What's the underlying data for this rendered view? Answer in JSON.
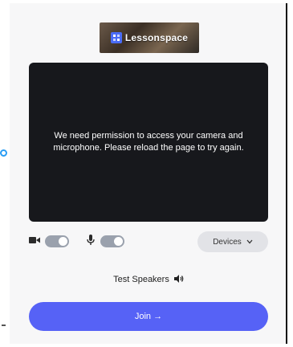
{
  "brand": {
    "name": "Lessonspace",
    "accent": "#4a6cf7",
    "icon": "lessonspace-logo-icon"
  },
  "video": {
    "message": "We need permission to access your camera and microphone. Please reload the page to try again."
  },
  "controls": {
    "camera_icon": "camera-icon",
    "camera_enabled": true,
    "mic_icon": "microphone-icon",
    "mic_enabled": true,
    "devices_label": "Devices",
    "devices_icon": "chevron-down-icon"
  },
  "speakers": {
    "label": "Test Speakers",
    "icon": "speaker-icon"
  },
  "join": {
    "label": "Join →",
    "color": "#5662f6"
  }
}
